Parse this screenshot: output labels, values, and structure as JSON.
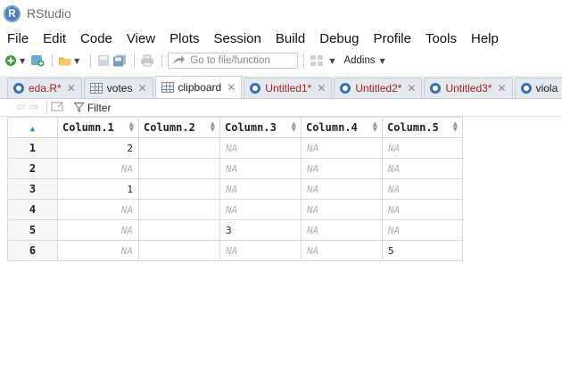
{
  "window": {
    "title": "RStudio"
  },
  "menu": [
    "File",
    "Edit",
    "Code",
    "View",
    "Plots",
    "Session",
    "Build",
    "Debug",
    "Profile",
    "Tools",
    "Help"
  ],
  "toolbar": {
    "goto_placeholder": "Go to file/function",
    "addins_label": "Addins"
  },
  "tabs": [
    {
      "label": "eda.R*",
      "icon": "r-script-icon",
      "modified": true,
      "active": false
    },
    {
      "label": "votes",
      "icon": "data-grid-icon",
      "modified": false,
      "active": false
    },
    {
      "label": "clipboard",
      "icon": "data-grid-icon",
      "modified": false,
      "active": true
    },
    {
      "label": "Untitled1*",
      "icon": "r-script-icon",
      "modified": true,
      "active": false
    },
    {
      "label": "Untitled2*",
      "icon": "r-script-icon",
      "modified": true,
      "active": false
    },
    {
      "label": "Untitled3*",
      "icon": "r-script-icon",
      "modified": true,
      "active": false
    },
    {
      "label": "viola",
      "icon": "r-script-icon",
      "modified": false,
      "active": false
    }
  ],
  "viewer": {
    "filter_label": "Filter"
  },
  "table": {
    "columns": [
      "Column.1",
      "Column.2",
      "Column.3",
      "Column.4",
      "Column.5"
    ],
    "rows": [
      {
        "id": "1",
        "cells": [
          "2",
          "",
          "NA",
          "NA",
          "NA"
        ]
      },
      {
        "id": "2",
        "cells": [
          "NA",
          "",
          "NA",
          "NA",
          "NA"
        ]
      },
      {
        "id": "3",
        "cells": [
          "1",
          "",
          "NA",
          "NA",
          "NA"
        ]
      },
      {
        "id": "4",
        "cells": [
          "NA",
          "",
          "NA",
          "NA",
          "NA"
        ]
      },
      {
        "id": "5",
        "cells": [
          "NA",
          "",
          "3",
          "NA",
          "NA"
        ]
      },
      {
        "id": "6",
        "cells": [
          "NA",
          "",
          "NA",
          "NA",
          "5"
        ]
      }
    ]
  },
  "colors": {
    "modified_tab": "#b11c1c",
    "na_text": "#b3b3b3",
    "accent": "#2f7fd6"
  }
}
